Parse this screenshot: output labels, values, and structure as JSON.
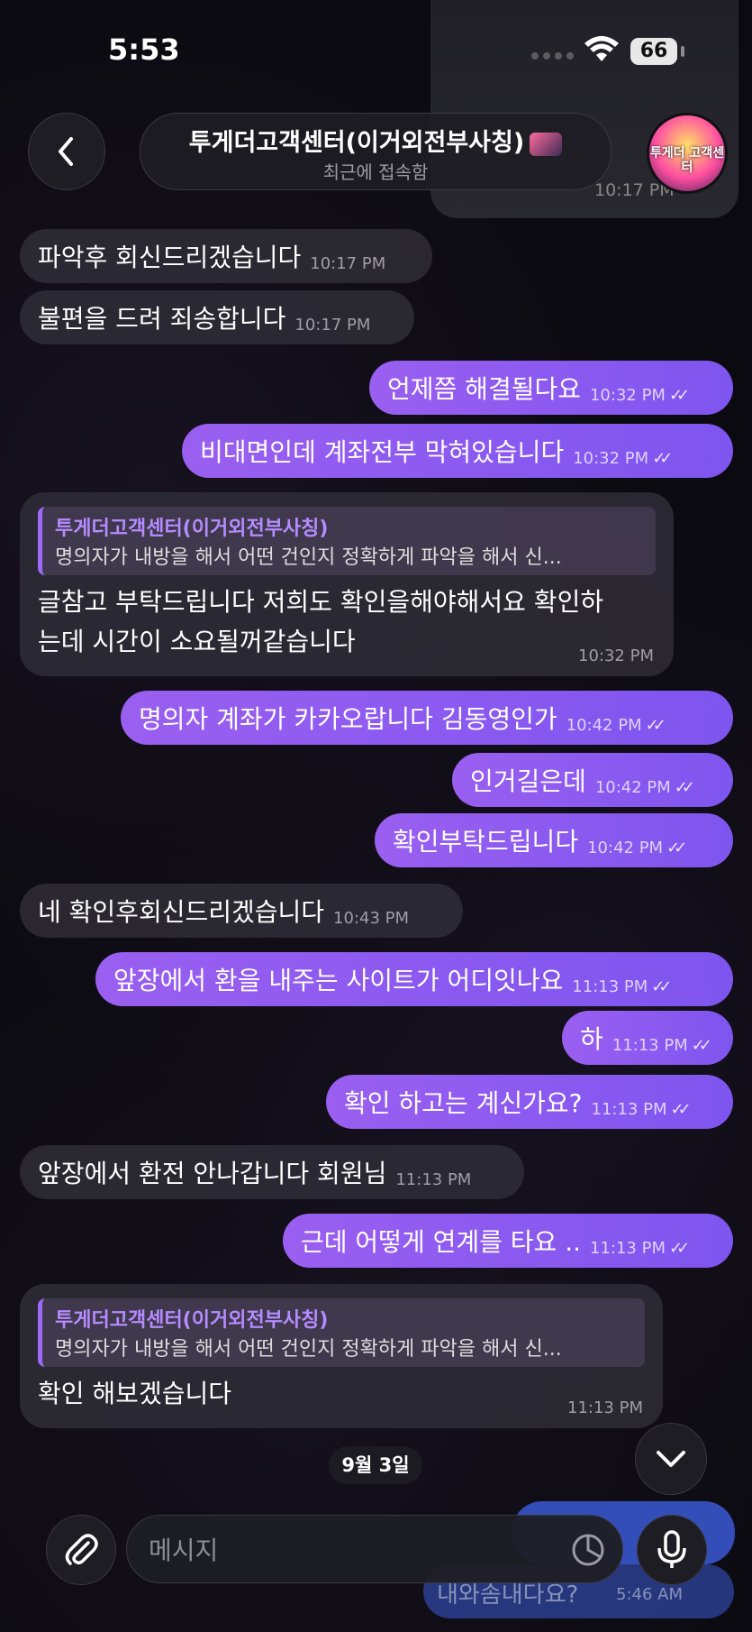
{
  "status": {
    "time": "5:53",
    "battery": "66"
  },
  "header": {
    "title": "투게더고객센터(이거외전부사칭)",
    "subtitle": "최근에 접속함",
    "avatar_text": "투게더 고객센터"
  },
  "top_ghost_time": "10:17 PM",
  "messages": [
    {
      "dir": "in",
      "text": "파악후 회신드리겠습니다",
      "time": "10:17 PM"
    },
    {
      "dir": "in",
      "text": "불편을 드려 죄송합니다",
      "time": "10:17 PM"
    },
    {
      "dir": "out",
      "text": "언제쯤 해결될다요",
      "time": "10:32 PM"
    },
    {
      "dir": "out",
      "text": "비대면인데 계좌전부 막혀있습니다",
      "time": "10:32 PM"
    },
    {
      "dir": "out",
      "text": "명의자 계좌가 카카오랍니다 김동영인가",
      "time": "10:42 PM"
    },
    {
      "dir": "out",
      "text": "인거길은데",
      "time": "10:42 PM"
    },
    {
      "dir": "out",
      "text": "확인부탁드립니다",
      "time": "10:42 PM"
    },
    {
      "dir": "in",
      "text": "네 확인후회신드리겠습니다",
      "time": "10:43 PM"
    },
    {
      "dir": "out",
      "text": "앞장에서 환을 내주는 사이트가 어디잇나요",
      "time": "11:13 PM"
    },
    {
      "dir": "out",
      "text": "하",
      "time": "11:13 PM"
    },
    {
      "dir": "out",
      "text": "확인 하고는 계신가요?",
      "time": "11:13 PM"
    },
    {
      "dir": "in",
      "text": "앞장에서 환전 안나갑니다 회원님",
      "time": "11:13 PM"
    },
    {
      "dir": "out",
      "text": "근데 어떻게 연계를 타요 ..",
      "time": "11:13 PM"
    }
  ],
  "replies": [
    {
      "quote_name": "투게더고객센터(이거외전부사칭)",
      "quote_text": "명의자가 내방을 해서 어떤 건인지 정확하게 파악을 해서 신...",
      "line1": "글참고 부탁드립니다 저희도 확인을해야해서요 확인하",
      "line2": "는데 시간이 소요될꺼같습니다",
      "time": "10:32 PM"
    },
    {
      "quote_name": "투게더고객센터(이거외전부사칭)",
      "quote_text": "명의자가 내방을 해서 어떤 건인지 정확하게 파악을 해서 신...",
      "line1": "확인 해보겠습니다",
      "line2": "",
      "time": "11:13 PM"
    }
  ],
  "date_chip": "9월 3일",
  "bottom_ghost": {
    "text": "내와솜내다요?",
    "time": "5:46 AM"
  },
  "composer": {
    "placeholder": "메시지"
  },
  "colors": {
    "accent": "#8b5cf6",
    "incoming": "#2d2a34",
    "background": "#0b0a10"
  }
}
